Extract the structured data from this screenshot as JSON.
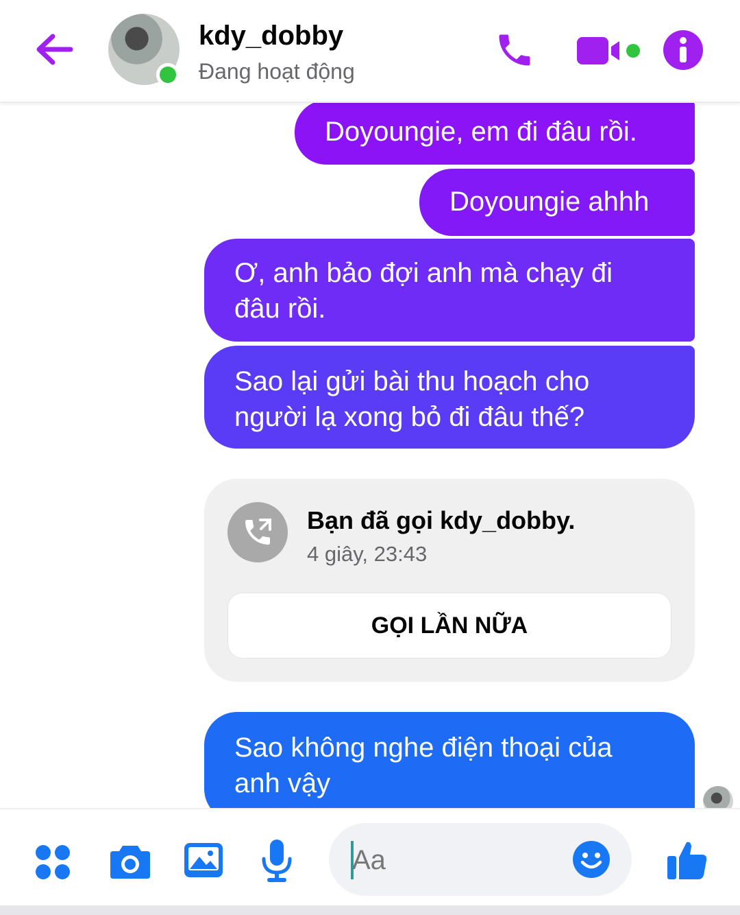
{
  "header": {
    "name": "kdy_dobby",
    "status": "Đang hoạt động"
  },
  "messages": [
    {
      "text": "Doyoungie, em đi đâu rồi."
    },
    {
      "text": "Doyoungie ahhh"
    },
    {
      "text": "Ơ, anh bảo đợi anh mà chạy đi đâu rồi."
    },
    {
      "text": "Sao lại gửi bài thu hoạch cho người lạ xong bỏ đi đâu thế?"
    },
    {
      "text": "Sao không nghe điện thoại của anh vậy"
    }
  ],
  "call_card": {
    "title": "Bạn đã gọi kdy_dobby.",
    "meta": "4 giây, 23:43",
    "button": "GỌI LẦN NỮA"
  },
  "composer": {
    "placeholder": "Aa"
  },
  "icons": {
    "back": "arrow-left-icon",
    "call": "phone-icon",
    "video": "video-camera-icon",
    "info": "info-icon",
    "menu": "four-dots-icon",
    "camera": "camera-icon",
    "gallery": "image-icon",
    "mic": "microphone-icon",
    "emoji": "smile-icon",
    "like": "thumbs-up-icon"
  },
  "colors": {
    "accent_purple": "#a020f0",
    "accent_blue": "#1877f2",
    "online_green": "#31c43f"
  }
}
